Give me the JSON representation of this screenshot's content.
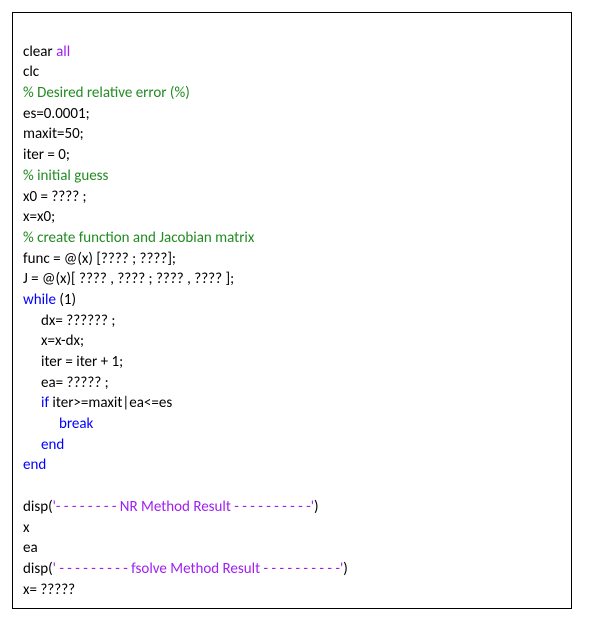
{
  "code": {
    "l1a": "clear ",
    "l1b": "all",
    "l2": "clc",
    "l3": "% Desired relative error (%)",
    "l4": "es=0.0001;",
    "l5": "maxit=50;",
    "l6": "iter = 0;",
    "l7": "% initial guess",
    "l8": "x0 = ???? ;",
    "l9": "x=x0;",
    "l10": "% create function and Jacobian matrix",
    "l11": "func = @(x) [???? ; ????];",
    "l12": "J = @(x)[ ???? , ???? ; ???? , ???? ];",
    "l13a": "while ",
    "l13b": "(1)",
    "l14": "dx= ?????? ;",
    "l15": "x=x-dx;",
    "l16": "iter = iter + 1;",
    "l17": "ea= ????? ;",
    "l18a": "if ",
    "l18b": "iter>=maxit|ea<=es",
    "l19": "break",
    "l20": "end",
    "l21": "end",
    "l22": "",
    "l23a": "disp(",
    "l23b": "'- - - - - - - - NR Method Result - - - - - - - - - -'",
    "l23c": ")",
    "l24": "x",
    "l25": "ea",
    "l26a": "disp(",
    "l26b": "' - - - - - - - - - fsolve Method Result - - - - - - - - - -'",
    "l26c": ")",
    "l27": "x= ?????"
  }
}
